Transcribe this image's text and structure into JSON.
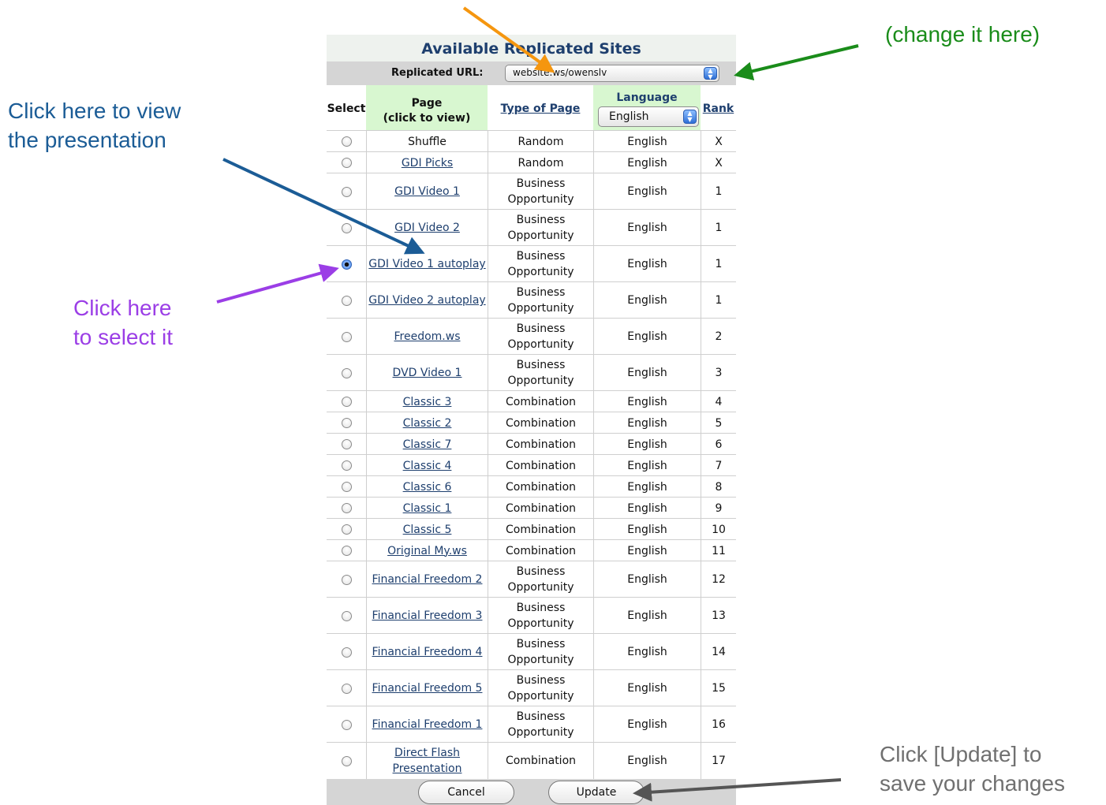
{
  "panel": {
    "title": "Available Replicated Sites",
    "url_label": "Replicated URL:",
    "url_value": "website.ws/owenslv"
  },
  "headers": {
    "select": "Select",
    "page_line1": "Page",
    "page_line2": "(click to view)",
    "type": "Type of Page",
    "language": "Language",
    "language_value": "English",
    "rank": "Rank"
  },
  "rows": [
    {
      "page": "Shuffle",
      "link": false,
      "type": "Random",
      "lang": "English",
      "rank": "X",
      "selected": false
    },
    {
      "page": "GDI Picks",
      "link": true,
      "type": "Random",
      "lang": "English",
      "rank": "X",
      "selected": false
    },
    {
      "page": "GDI Video 1",
      "link": true,
      "type": "Business Opportunity",
      "lang": "English",
      "rank": "1",
      "selected": false
    },
    {
      "page": "GDI Video 2",
      "link": true,
      "type": "Business Opportunity",
      "lang": "English",
      "rank": "1",
      "selected": false
    },
    {
      "page": "GDI Video 1 autoplay",
      "link": true,
      "type": "Business Opportunity",
      "lang": "English",
      "rank": "1",
      "selected": true
    },
    {
      "page": "GDI Video 2 autoplay",
      "link": true,
      "type": "Business Opportunity",
      "lang": "English",
      "rank": "1",
      "selected": false
    },
    {
      "page": "Freedom.ws",
      "link": true,
      "type": "Business Opportunity",
      "lang": "English",
      "rank": "2",
      "selected": false
    },
    {
      "page": "DVD Video 1",
      "link": true,
      "type": "Business Opportunity",
      "lang": "English",
      "rank": "3",
      "selected": false
    },
    {
      "page": "Classic 3",
      "link": true,
      "type": "Combination",
      "lang": "English",
      "rank": "4",
      "selected": false
    },
    {
      "page": "Classic 2",
      "link": true,
      "type": "Combination",
      "lang": "English",
      "rank": "5",
      "selected": false
    },
    {
      "page": "Classic 7",
      "link": true,
      "type": "Combination",
      "lang": "English",
      "rank": "6",
      "selected": false
    },
    {
      "page": "Classic 4",
      "link": true,
      "type": "Combination",
      "lang": "English",
      "rank": "7",
      "selected": false
    },
    {
      "page": "Classic 6",
      "link": true,
      "type": "Combination",
      "lang": "English",
      "rank": "8",
      "selected": false
    },
    {
      "page": "Classic 1",
      "link": true,
      "type": "Combination",
      "lang": "English",
      "rank": "9",
      "selected": false
    },
    {
      "page": "Classic 5",
      "link": true,
      "type": "Combination",
      "lang": "English",
      "rank": "10",
      "selected": false
    },
    {
      "page": "Original My.ws",
      "link": true,
      "type": "Combination",
      "lang": "English",
      "rank": "11",
      "selected": false
    },
    {
      "page": "Financial Freedom 2",
      "link": true,
      "type": "Business Opportunity",
      "lang": "English",
      "rank": "12",
      "selected": false
    },
    {
      "page": "Financial Freedom 3",
      "link": true,
      "type": "Business Opportunity",
      "lang": "English",
      "rank": "13",
      "selected": false
    },
    {
      "page": "Financial Freedom 4",
      "link": true,
      "type": "Business Opportunity",
      "lang": "English",
      "rank": "14",
      "selected": false
    },
    {
      "page": "Financial Freedom 5",
      "link": true,
      "type": "Business Opportunity",
      "lang": "English",
      "rank": "15",
      "selected": false
    },
    {
      "page": "Financial Freedom 1",
      "link": true,
      "type": "Business Opportunity",
      "lang": "English",
      "rank": "16",
      "selected": false
    },
    {
      "page": "Direct Flash Presentation",
      "link": true,
      "type": "Combination",
      "lang": "English",
      "rank": "17",
      "selected": false
    }
  ],
  "footer": {
    "cancel_label": "Cancel",
    "update_label": "Update"
  },
  "annotations": {
    "view_line1": "Click here to view",
    "view_line2": "the presentation",
    "select_line1": "Click here",
    "select_line2": "to select it",
    "change": "(change it here)",
    "update_line1": "Click [Update] to",
    "update_line2": "save your changes"
  },
  "colors": {
    "view_note": "#1b5c96",
    "select_note": "#9b3ee6",
    "change_note": "#1a8c1a",
    "update_note": "#707070",
    "orange_arrow": "#f5960f",
    "title_text": "#1e3f6e",
    "header_green": "#d8f7d0"
  }
}
